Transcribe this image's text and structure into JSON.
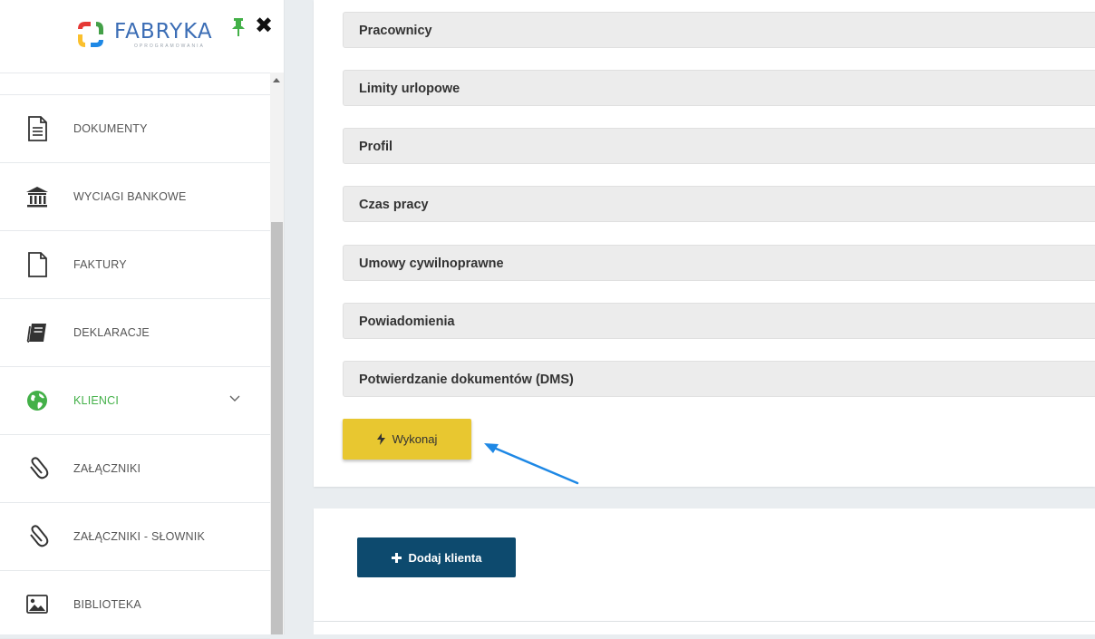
{
  "brand": {
    "name": "FABRYKA",
    "subtitle": "OPROGRAMOWANIA"
  },
  "sidebar": {
    "items": [
      {
        "label": "DOKUMENTY",
        "icon": "document-icon"
      },
      {
        "label": "WYCIAGI BANKOWE",
        "icon": "bank-icon"
      },
      {
        "label": "FAKTURY",
        "icon": "file-icon"
      },
      {
        "label": "DEKLARACJE",
        "icon": "book-icon"
      },
      {
        "label": "KLIENCI",
        "icon": "globe-icon",
        "active": true
      },
      {
        "label": "ZAŁĄCZNIKI",
        "icon": "paperclip-icon"
      },
      {
        "label": "ZAŁĄCZNIKI - SŁOWNIK",
        "icon": "paperclip-icon"
      },
      {
        "label": "BIBLIOTEKA",
        "icon": "image-icon"
      }
    ]
  },
  "main": {
    "sections": [
      {
        "label": "Pracownicy"
      },
      {
        "label": "Limity urlopowe"
      },
      {
        "label": "Profil"
      },
      {
        "label": "Czas pracy"
      },
      {
        "label": "Umowy cywilnoprawne"
      },
      {
        "label": "Powiadomienia"
      },
      {
        "label": "Potwierdzanie dokumentów (DMS)"
      }
    ],
    "run_button": "Wykonaj",
    "add_client_button": "Dodaj klienta"
  },
  "colors": {
    "accent_green": "#43b048",
    "run_yellow": "#e8c730",
    "add_blue": "#0d4a6e",
    "arrow_blue": "#1e88e5"
  }
}
